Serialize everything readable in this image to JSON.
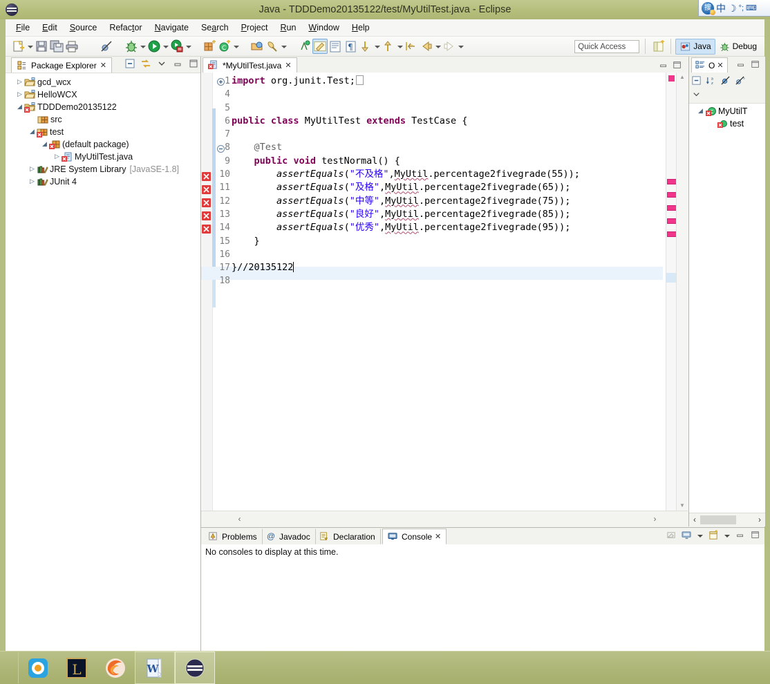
{
  "window": {
    "title": "Java - TDDDemo20135122/test/MyUtilTest.java - Eclipse",
    "app_icon": "eclipse-icon"
  },
  "ime": {
    "logo": "sogou-ime-logo",
    "glyphs": [
      "中",
      "☽",
      "°;",
      "⌨"
    ]
  },
  "menubar": {
    "items": [
      {
        "label": "File",
        "mnemonic": "F"
      },
      {
        "label": "Edit",
        "mnemonic": "E"
      },
      {
        "label": "Source",
        "mnemonic": "S"
      },
      {
        "label": "Refactor",
        "mnemonic": "t"
      },
      {
        "label": "Navigate",
        "mnemonic": "N"
      },
      {
        "label": "Search",
        "mnemonic": "a"
      },
      {
        "label": "Project",
        "mnemonic": "P"
      },
      {
        "label": "Run",
        "mnemonic": "R"
      },
      {
        "label": "Window",
        "mnemonic": "W"
      },
      {
        "label": "Help",
        "mnemonic": "H"
      }
    ]
  },
  "toolbar": {
    "icons": [
      "new-icon",
      "save-icon",
      "save-all-icon",
      "print-icon",
      "toggle-breakpoint-icon",
      "debug-icon",
      "run-icon",
      "run-coverage-icon",
      "new-java-package-icon",
      "new-java-class-icon",
      "open-type-icon",
      "search-icon",
      "toggle-markoccurrences-icon",
      "toggle-blockselection-icon",
      "show-whitespace-icon",
      "next-annotation-icon",
      "previous-annotation-icon",
      "last-edit-location-icon",
      "back-icon",
      "forward-icon"
    ],
    "quick_access_placeholder": "Quick Access",
    "open-perspective-icon": "open-perspective-icon",
    "perspectives": [
      {
        "label": "Java",
        "icon": "java-perspective-icon",
        "active": true
      },
      {
        "label": "Debug",
        "icon": "debug-perspective-icon",
        "active": false
      }
    ]
  },
  "package_explorer": {
    "tab_label": "Package Explorer",
    "tab_icon": "package-explorer-icon",
    "close_glyph": "✕",
    "toolbar_icons": [
      "collapse-all-icon",
      "link-with-editor-icon",
      "view-menu-icon",
      "minimize-icon",
      "maximize-icon"
    ],
    "tree": [
      {
        "label": "gcd_wcx",
        "icon": "java-project-icon",
        "indent": 0,
        "twisty": "collapsed",
        "error": false
      },
      {
        "label": "HelloWCX",
        "icon": "java-project-icon",
        "indent": 0,
        "twisty": "collapsed",
        "error": false
      },
      {
        "label": "TDDDemo20135122",
        "icon": "java-project-icon",
        "indent": 0,
        "twisty": "expanded",
        "error": true
      },
      {
        "label": "src",
        "icon": "source-folder-icon",
        "indent": 1,
        "twisty": "none",
        "error": false
      },
      {
        "label": "test",
        "icon": "source-folder-icon",
        "indent": 1,
        "twisty": "expanded",
        "error": true
      },
      {
        "label": "(default package)",
        "icon": "package-icon",
        "indent": 2,
        "twisty": "expanded",
        "error": true
      },
      {
        "label": "MyUtilTest.java",
        "icon": "java-file-icon",
        "indent": 3,
        "twisty": "collapsed",
        "error": true
      },
      {
        "label": "JRE System Library",
        "suffix": "[JavaSE-1.8]",
        "icon": "library-icon",
        "indent": 1,
        "twisty": "collapsed",
        "error": false
      },
      {
        "label": "JUnit 4",
        "icon": "library-icon",
        "indent": 1,
        "twisty": "collapsed",
        "error": false
      }
    ]
  },
  "editor": {
    "tab_label": "*MyUtilTest.java",
    "tab_icon": "java-file-error-icon",
    "close_glyph": "✕",
    "minimize_icon": "minimize-icon",
    "maximize_icon": "maximize-icon",
    "lines": [
      {
        "num": "1",
        "fold": "plus",
        "marker": "none",
        "text": "import org.junit.Test;"
      },
      {
        "num": "4",
        "fold": "none",
        "marker": "none",
        "text": ""
      },
      {
        "num": "5",
        "fold": "none",
        "marker": "none",
        "text": ""
      },
      {
        "num": "6",
        "fold": "none",
        "marker": "none",
        "text": "public class MyUtilTest extends TestCase {"
      },
      {
        "num": "7",
        "fold": "none",
        "marker": "none",
        "text": ""
      },
      {
        "num": "8",
        "fold": "minus",
        "marker": "none",
        "text": "    @Test"
      },
      {
        "num": "9",
        "fold": "none",
        "marker": "none",
        "text": "    public void testNormal() {"
      },
      {
        "num": "10",
        "fold": "none",
        "marker": "error",
        "text": "        assertEquals(\"不及格\",MyUtil.percentage2fivegrade(55));"
      },
      {
        "num": "11",
        "fold": "none",
        "marker": "error",
        "text": "        assertEquals(\"及格\",MyUtil.percentage2fivegrade(65));"
      },
      {
        "num": "12",
        "fold": "none",
        "marker": "error",
        "text": "        assertEquals(\"中等\",MyUtil.percentage2fivegrade(75));"
      },
      {
        "num": "13",
        "fold": "none",
        "marker": "error",
        "text": "        assertEquals(\"良好\",MyUtil.percentage2fivegrade(85));"
      },
      {
        "num": "14",
        "fold": "none",
        "marker": "error",
        "text": "        assertEquals(\"优秀\",MyUtil.percentage2fivegrade(95));"
      },
      {
        "num": "15",
        "fold": "none",
        "marker": "none",
        "text": "    }"
      },
      {
        "num": "16",
        "fold": "none",
        "marker": "none",
        "text": ""
      },
      {
        "num": "17",
        "fold": "none",
        "marker": "none",
        "text": "}//20135122"
      },
      {
        "num": "18",
        "fold": "none",
        "marker": "none",
        "text": ""
      }
    ],
    "code": {
      "l1_kw": "import",
      "l1_rest": " org.junit.Test;",
      "l6_kw1": "public",
      "l6_kw2": "class",
      "l6_name": " MyUtilTest ",
      "l6_kw3": "extends",
      "l6_tail": " TestCase {",
      "l8_annotation": "    @Test",
      "l9_kw1": "public",
      "l9_kw2": "void",
      "l9_tail": " testNormal() {",
      "assert_name": "assertEquals",
      "grades": [
        "不及格",
        "及格",
        "中等",
        "良好",
        "优秀"
      ],
      "scores": [
        "55",
        "65",
        "75",
        "85",
        "95"
      ],
      "receiver": "MyUtil",
      "method": ".percentage2fivegrade(",
      "tail": "));",
      "l15": "    }",
      "l17": "}//20135122"
    },
    "ruler_markers": 5,
    "scroll": {
      "up_glyph": "▲",
      "down_glyph": "▼",
      "left_glyph": "‹",
      "right_glyph": "›"
    }
  },
  "outline": {
    "tab_label": "O",
    "tab_icon": "outline-icon",
    "close_glyph": "✕",
    "minimize_icon": "minimize-icon",
    "maximize_icon": "maximize-icon",
    "toolbar_icons": [
      "collapse-all-icon",
      "sort-icon",
      "hide-fields-icon",
      "hide-static-icon",
      "hide-nonpublic-icon",
      "view-menu-icon"
    ],
    "tree": [
      {
        "label": "MyUtilT",
        "icon": "class-error-icon",
        "indent": 0,
        "twisty": "expanded"
      },
      {
        "label": "test",
        "icon": "method-error-icon",
        "indent": 1,
        "twisty": "none"
      }
    ],
    "scroll": {
      "left_glyph": "‹",
      "right_glyph": "›"
    }
  },
  "bottom_panel": {
    "tabs": [
      {
        "label": "Problems",
        "icon": "problems-icon",
        "active": false
      },
      {
        "label": "Javadoc",
        "icon": "javadoc-icon",
        "active": false
      },
      {
        "label": "Declaration",
        "icon": "declaration-icon",
        "active": false
      },
      {
        "label": "Console",
        "icon": "console-icon",
        "active": true
      }
    ],
    "close_glyph": "✕",
    "tools": [
      "clear-console-icon",
      "display-selected-console-icon",
      "open-console-icon",
      "minimize-icon",
      "maximize-icon"
    ],
    "console_message": "No consoles to display at this time."
  },
  "taskbar": {
    "items": [
      {
        "name": "pplive-icon",
        "label": ""
      },
      {
        "name": "league-of-legends-icon",
        "label": "L"
      },
      {
        "name": "firefox-icon",
        "label": ""
      },
      {
        "name": "word-icon",
        "label": "W"
      },
      {
        "name": "eclipse-icon",
        "label": "",
        "selected": true
      }
    ]
  },
  "colors": {
    "titlebar": "#b4bd82",
    "keyword": "#7f0055",
    "string": "#2a00ff",
    "comment": "#3f7f5f",
    "annotation": "#646464",
    "error_marker": "#f0358a",
    "selection": "#cfe3f7"
  }
}
